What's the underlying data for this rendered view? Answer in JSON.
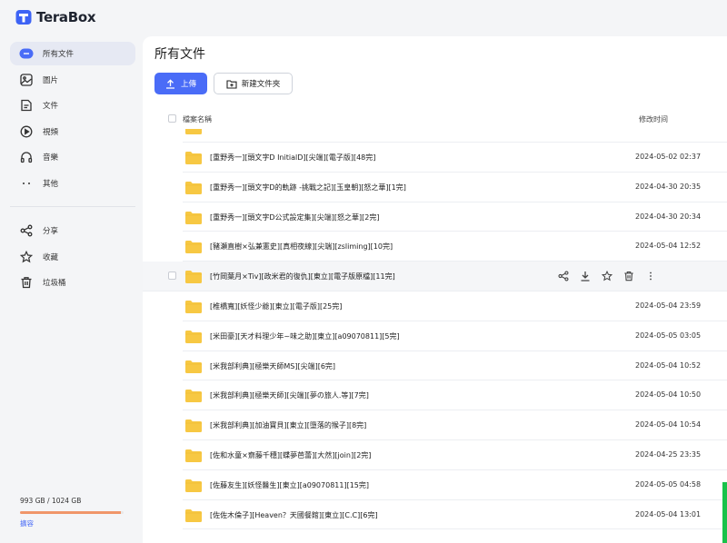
{
  "app": {
    "name": "TeraBox"
  },
  "sidebar": {
    "items": [
      {
        "label": "所有文件",
        "icon": "all-files-icon",
        "active": true
      },
      {
        "label": "圖片",
        "icon": "image-icon"
      },
      {
        "label": "文件",
        "icon": "document-icon"
      },
      {
        "label": "視頻",
        "icon": "video-icon"
      },
      {
        "label": "音樂",
        "icon": "music-icon"
      },
      {
        "label": "其他",
        "icon": "more-icon"
      }
    ],
    "items2": [
      {
        "label": "分享",
        "icon": "share-icon"
      },
      {
        "label": "收藏",
        "icon": "star-icon"
      },
      {
        "label": "垃圾桶",
        "icon": "trash-icon"
      }
    ],
    "storage": {
      "text": "993 GB / 1024 GB",
      "used_fraction": 0.97,
      "expand_label": "擴容"
    }
  },
  "main": {
    "title": "所有文件",
    "upload_label": "上傳",
    "new_folder_label": "新建文件夾",
    "columns": {
      "name": "檔案名稱",
      "time": "修改时间"
    },
    "rows": [
      {
        "name": "[重野秀一][頭文字D InitialD][尖端][電子版][48完]",
        "time": "2024-05-02 02:37"
      },
      {
        "name": "[重野秀一][頭文字D的軌跡 -挑戰之記][玉皇朝][怒之華][1完]",
        "time": "2024-04-30 20:35"
      },
      {
        "name": "[重野秀一][頭文字D公式設定集][尖端][怒之華][2完]",
        "time": "2024-04-30 20:34"
      },
      {
        "name": "[豬瀬直樹×弘兼憲史][真相夜線][尖端][zsliming][10完]",
        "time": "2024-05-04 12:52"
      },
      {
        "name": "[竹岡葉月×Tiv][政米君的復仇][東立][電子版原檔][11完]",
        "time": "",
        "hover": true
      },
      {
        "name": "[椎橋寬][妖怪少爺][東立][電子版][25完]",
        "time": "2024-05-04 23:59"
      },
      {
        "name": "[米田豪][天才料理少年~味之助][東立][a09070811][5完]",
        "time": "2024-05-05 03:05"
      },
      {
        "name": "[米我部利典][極樂天師MS][尖端][6完]",
        "time": "2024-05-04 10:52"
      },
      {
        "name": "[米我部利典][極樂天師][尖端][夢の旅人.等][7完]",
        "time": "2024-05-04 10:50"
      },
      {
        "name": "[米我部利典][加油寶貝][東立][墮落的猴子][8完]",
        "time": "2024-05-04 10:54"
      },
      {
        "name": "[佐和水童×齋藤千穗][蝶夢芭蕾][大然][join][2完]",
        "time": "2024-04-25 23:35"
      },
      {
        "name": "[佐藤友生][妖怪醫生][東立][a09070811][15完]",
        "time": "2024-05-05 04:58"
      },
      {
        "name": "[佐佐木倫子][Heaven？天國餐館][東立][C.C][6完]",
        "time": "2024-05-04 13:01"
      }
    ]
  },
  "colors": {
    "accent": "#4a6cf7",
    "folder": "#f7c843",
    "storage": "#f0966a"
  }
}
